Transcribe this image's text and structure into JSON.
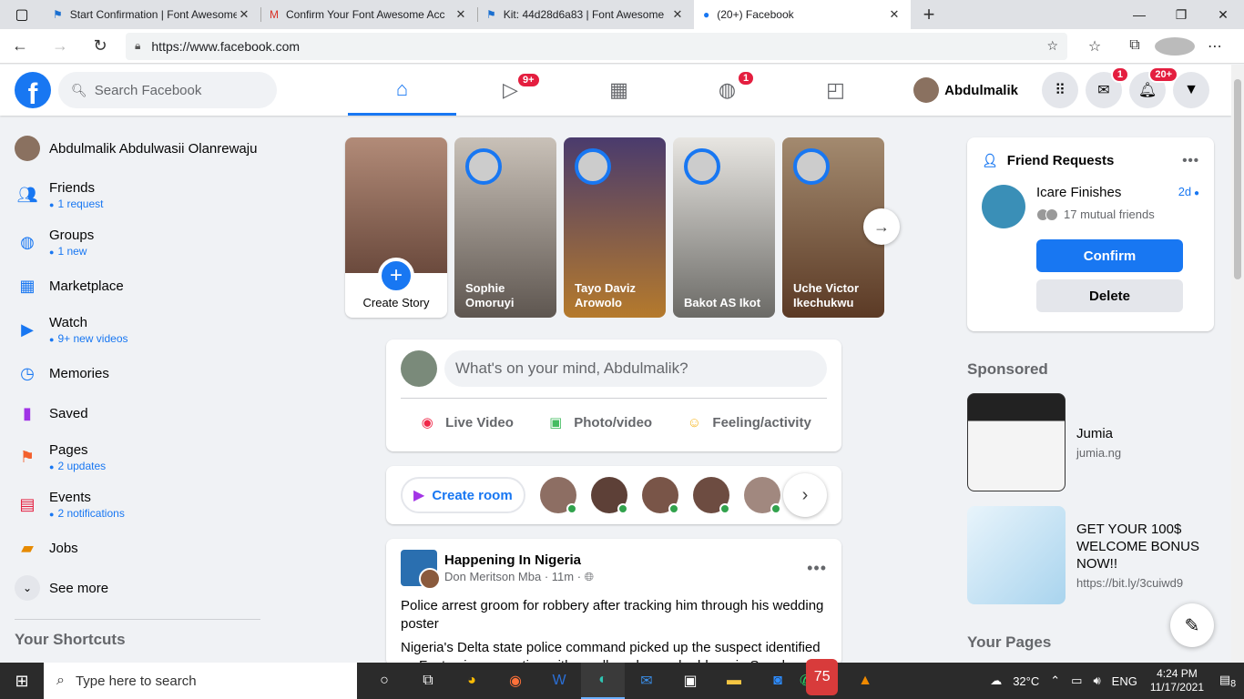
{
  "browser": {
    "tabs": [
      {
        "title": "Start Confirmation | Font Awesome",
        "icon": "flag-icon",
        "active": false
      },
      {
        "title": "Confirm Your Font Awesome Acc",
        "icon": "gmail-icon",
        "active": false
      },
      {
        "title": "Kit: 44d28d6a83 | Font Awesome",
        "icon": "flag-icon",
        "active": false
      },
      {
        "title": "(20+) Facebook",
        "icon": "facebook-icon",
        "active": true
      }
    ],
    "url": "https://www.facebook.com"
  },
  "fb": {
    "logo": "f",
    "search_placeholder": "Search Facebook",
    "nav_badges": {
      "watch": "9+",
      "groups": "1"
    },
    "profile_name": "Abdulmalik",
    "badges": {
      "messenger": "1",
      "notifications": "20+"
    },
    "accent": "#1877f2"
  },
  "sidebar": {
    "profile": "Abdulmalik Abdulwasii Olanrewaju",
    "items": [
      {
        "label": "Friends",
        "sub": "1 request"
      },
      {
        "label": "Groups",
        "sub": "1 new"
      },
      {
        "label": "Marketplace",
        "sub": ""
      },
      {
        "label": "Watch",
        "sub": "9+ new videos"
      },
      {
        "label": "Memories",
        "sub": ""
      },
      {
        "label": "Saved",
        "sub": ""
      },
      {
        "label": "Pages",
        "sub": "2 updates"
      },
      {
        "label": "Events",
        "sub": "2 notifications"
      },
      {
        "label": "Jobs",
        "sub": ""
      }
    ],
    "see_more": "See more",
    "shortcuts_heading": "Your Shortcuts"
  },
  "stories": {
    "create_label": "Create Story",
    "items": [
      {
        "name": "Sophie Omoruyi"
      },
      {
        "name": "Tayo Daviz Arowolo"
      },
      {
        "name": "Bakot AS Ikot"
      },
      {
        "name": "Uche Victor Ikechukwu"
      }
    ]
  },
  "composer": {
    "placeholder": "What's on your mind, Abdulmalik?",
    "live": "Live Video",
    "photo": "Photo/video",
    "feeling": "Feeling/activity"
  },
  "rooms": {
    "create_label": "Create room"
  },
  "post": {
    "page_name": "Happening In Nigeria",
    "author": "Don Meritson Mba",
    "time": "11m",
    "headline": "Police arrest groom for robbery after tracking him through his wedding poster",
    "body": "Nigeria's Delta state police command picked up the suspect identified as Festus in connection with an alleged armed robbery in Sapele"
  },
  "friend_requests": {
    "heading": "Friend Requests",
    "name": "Icare Finishes",
    "time": "2d",
    "mutual": "17 mutual friends",
    "confirm": "Confirm",
    "delete": "Delete"
  },
  "sponsored": {
    "heading": "Sponsored",
    "ads": [
      {
        "title": "Jumia",
        "link": "jumia.ng"
      },
      {
        "title": "GET YOUR 100$ WELCOME BONUS NOW!!",
        "link": "https://bit.ly/3cuiwd9"
      }
    ]
  },
  "your_pages": "Your Pages",
  "taskbar": {
    "search_placeholder": "Type here to search",
    "whatsapp_badge": "75",
    "temperature": "32°C",
    "language": "ENG",
    "time": "4:24 PM",
    "date": "11/17/2021",
    "notifications": "8"
  }
}
